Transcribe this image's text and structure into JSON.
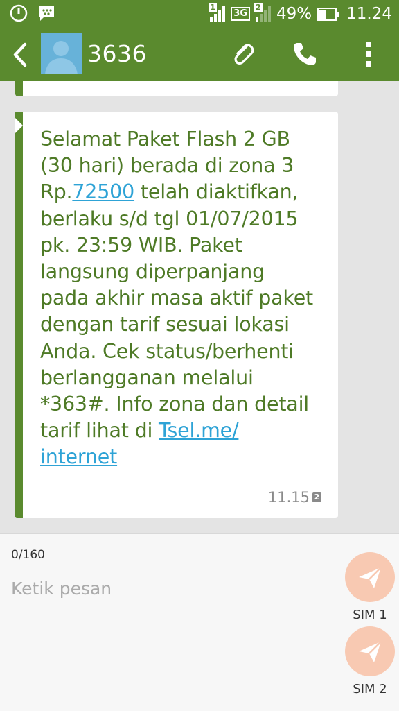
{
  "status_bar": {
    "sim1_badge": "1",
    "network_type": "3G",
    "sim2_badge": "2",
    "battery_percent": "49%",
    "battery_level": 0.49,
    "time": "11.24"
  },
  "header": {
    "contact_name": "3636"
  },
  "message": {
    "lines": [
      {
        "parts": [
          {
            "text": "Selamat Paket Flash 2 GB"
          }
        ]
      },
      {
        "parts": [
          {
            "text": "(30 hari) berada di zona 3"
          }
        ]
      },
      {
        "parts": [
          {
            "text": "Rp."
          },
          {
            "text": "72500",
            "link": true
          },
          {
            "text": " telah diaktifkan,"
          }
        ]
      },
      {
        "parts": [
          {
            "text": "berlaku s/d tgl 01/07/2015"
          }
        ]
      },
      {
        "parts": [
          {
            "text": "pk. 23:59 WIB. Paket"
          }
        ]
      },
      {
        "parts": [
          {
            "text": "langsung diperpanjang"
          }
        ]
      },
      {
        "parts": [
          {
            "text": "pada akhir masa aktif paket"
          }
        ]
      },
      {
        "parts": [
          {
            "text": "dengan tarif sesuai lokasi"
          }
        ]
      },
      {
        "parts": [
          {
            "text": "Anda. Cek status/berhenti"
          }
        ]
      },
      {
        "parts": [
          {
            "text": "berlangganan melalui"
          }
        ]
      },
      {
        "parts": [
          {
            "text": "*363#. Info zona dan detail"
          }
        ]
      },
      {
        "parts": [
          {
            "text": "tarif lihat di "
          },
          {
            "text": "Tsel.me/",
            "link": true
          }
        ]
      },
      {
        "parts": [
          {
            "text": "internet",
            "link": true
          }
        ]
      }
    ],
    "time": "11.15",
    "sim_slot": "2"
  },
  "compose": {
    "char_count": "0/160",
    "placeholder": "Ketik pesan",
    "send_sim1_label": "SIM 1",
    "send_sim2_label": "SIM 2"
  },
  "colors": {
    "brand_green": "#5a8a2e",
    "message_text": "#4e7a26",
    "link": "#2ea3d6",
    "send_button": "#f8c9b2"
  }
}
